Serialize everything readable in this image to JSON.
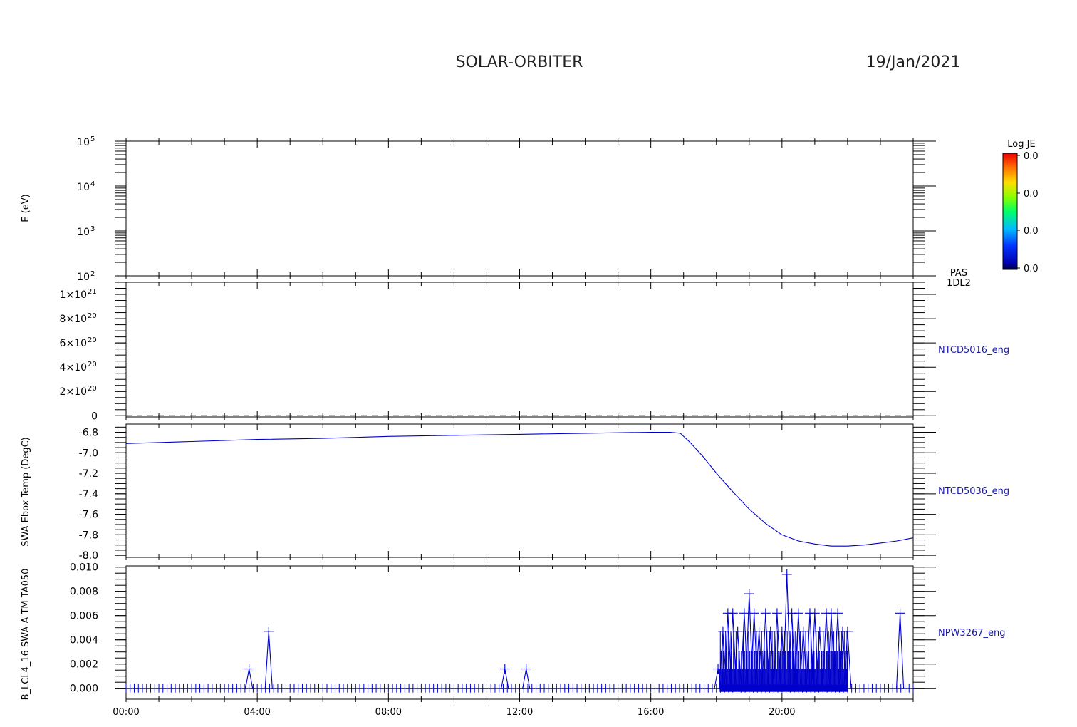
{
  "header": {
    "mission": "SOLAR-ORBITER",
    "date": "19/Jan/2021"
  },
  "colors": {
    "axes": "#000000",
    "trace": "#0000cc",
    "label": "#1a1aaa",
    "dashed": "#000000"
  },
  "time_axis": {
    "range_hours": [
      0,
      24
    ],
    "tick_labels": [
      "00:00",
      "04:00",
      "08:00",
      "12:00",
      "16:00",
      "20:00"
    ],
    "tick_hours": [
      0,
      4,
      8,
      12,
      16,
      20
    ],
    "minor_step_hours": 1
  },
  "colorbar": {
    "title": "Log JE",
    "labels": [
      "0.0",
      "0.0",
      "0.0",
      "0.0"
    ]
  },
  "chart_data": [
    {
      "type": "heatmap",
      "ylabel": "E (eV)",
      "yscale": "log",
      "ylim": [
        100,
        100000
      ],
      "tick_exponents": [
        "5",
        "4",
        "3",
        "2"
      ],
      "tick_base": "10",
      "side_label_1": "PAS",
      "side_label_2": "1DL2",
      "values": []
    },
    {
      "type": "line",
      "ylabel": "",
      "ylim": [
        -1e+19,
        1.1e+21
      ],
      "tick_labels": [
        "1×10",
        "8×10",
        "6×10",
        "4×10",
        "2×10",
        "0"
      ],
      "tick_exponents": [
        "21",
        "20",
        "20",
        "20",
        "20",
        ""
      ],
      "tick_values": [
        1e+21,
        8e+20,
        6e+20,
        4e+20,
        2e+20,
        0
      ],
      "series_label": "NTCD5016_eng",
      "style": "dashed",
      "x": [
        0,
        24
      ],
      "y": [
        0,
        0
      ]
    },
    {
      "type": "line",
      "ylabel": "SWA Ebox Temp (DegC)",
      "ylim": [
        -8.02,
        -6.72
      ],
      "tick_labels": [
        "-6.8",
        "-7.0",
        "-7.2",
        "-7.4",
        "-7.6",
        "-7.8",
        "-8.0"
      ],
      "tick_values": [
        -6.8,
        -7.0,
        -7.2,
        -7.4,
        -7.6,
        -7.8,
        -8.0
      ],
      "series_label": "NTCD5036_eng",
      "x": [
        0,
        2,
        4,
        6,
        8,
        10,
        12,
        14,
        15,
        16,
        16.6,
        16.9,
        17.2,
        17.6,
        18,
        18.5,
        19,
        19.5,
        20,
        20.5,
        21,
        21.5,
        22,
        22.5,
        23,
        23.5,
        24
      ],
      "y": [
        -6.91,
        -6.89,
        -6.87,
        -6.86,
        -6.84,
        -6.83,
        -6.82,
        -6.81,
        -6.805,
        -6.8,
        -6.8,
        -6.81,
        -6.9,
        -7.04,
        -7.2,
        -7.38,
        -7.55,
        -7.69,
        -7.8,
        -7.86,
        -7.89,
        -7.91,
        -7.91,
        -7.9,
        -7.88,
        -7.86,
        -7.83
      ]
    },
    {
      "type": "line",
      "ylabel": "B_LCL4_16 SWA-A TM TA050",
      "ylim": [
        -0.0009,
        0.0101
      ],
      "tick_labels": [
        "0.010",
        "0.008",
        "0.006",
        "0.004",
        "0.002",
        "0.000"
      ],
      "tick_values": [
        0.01,
        0.008,
        0.006,
        0.004,
        0.002,
        0.0
      ],
      "series_label": "NPW3267_eng",
      "baseline": 0,
      "sample_step_hours": 0.125,
      "x_start": 0,
      "x_end": 24,
      "dense_range": [
        18.1,
        22.0
      ],
      "dense_levels": [
        0.0016,
        0.0031,
        0.0047,
        0.0062,
        0.0078,
        0.0094
      ],
      "spikes_x": [
        3.75,
        4.35,
        11.55,
        12.2,
        18.05,
        18.2,
        18.35,
        18.5,
        18.65,
        18.85,
        19.0,
        19.15,
        19.3,
        19.5,
        19.65,
        19.85,
        20.0,
        20.15,
        20.3,
        20.5,
        20.65,
        20.85,
        21.0,
        21.15,
        21.35,
        21.5,
        21.7,
        21.85,
        22.0,
        23.6
      ],
      "spikes_y": [
        0.0016,
        0.0047,
        0.0016,
        0.0016,
        0.0016,
        0.0047,
        0.0062,
        0.0062,
        0.0047,
        0.0062,
        0.0078,
        0.0062,
        0.0047,
        0.0062,
        0.0047,
        0.0062,
        0.0047,
        0.0094,
        0.0062,
        0.0062,
        0.0047,
        0.0062,
        0.0062,
        0.0047,
        0.0062,
        0.0062,
        0.0062,
        0.0047,
        0.0047,
        0.0062
      ]
    }
  ]
}
